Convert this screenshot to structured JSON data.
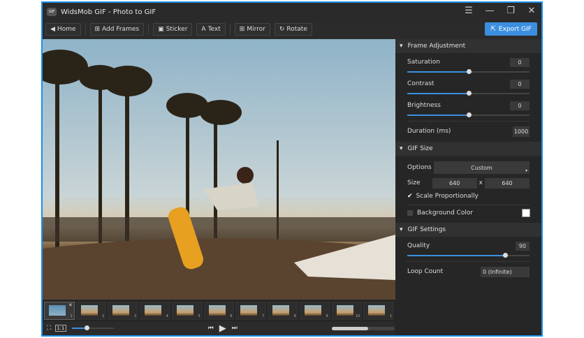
{
  "window": {
    "title": "WidsMob GIF - Photo to GIF",
    "logo": "GIF",
    "controls": [
      "☰",
      "—",
      "❐",
      "✕"
    ]
  },
  "toolbar": {
    "home": "Home",
    "add_frames": "Add Frames",
    "sticker": "Sticker",
    "text": "Text",
    "mirror": "Mirror",
    "rotate": "Rotate",
    "export": "Export GIF"
  },
  "frame_adjustment": {
    "title": "Frame Adjustment",
    "saturation_label": "Saturation",
    "saturation": "0",
    "saturation_pct": 50,
    "contrast_label": "Contrast",
    "contrast": "0",
    "contrast_pct": 50,
    "brightness_label": "Brightness",
    "brightness": "0",
    "brightness_pct": 50,
    "duration_label": "Duration (ms)",
    "duration": "1000"
  },
  "gif_size": {
    "title": "GIF Size",
    "options_label": "Options",
    "option": "Custom",
    "size_label": "Size",
    "width": "640",
    "x": "x",
    "height": "640",
    "scale_label": "Scale Proportionally",
    "scale_checked": true,
    "bg_label": "Background Color",
    "bg_checked": false,
    "bg_color": "#ffffff"
  },
  "gif_settings": {
    "title": "GIF Settings",
    "quality_label": "Quality",
    "quality": "90",
    "quality_pct": 80,
    "loop_label": "Loop Count",
    "loop": "0 (Infinite)"
  },
  "frames": [
    "1",
    "2",
    "3",
    "4",
    "5",
    "6",
    "7",
    "8",
    "9",
    "10",
    "1"
  ],
  "playback": {
    "zoom_pct": 35,
    "timeline_pct": 58
  },
  "colors": {
    "accent": "#3c8fe0",
    "border": "#1d8fe8"
  }
}
